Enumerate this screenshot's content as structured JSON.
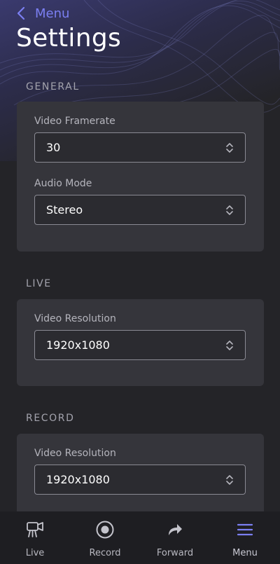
{
  "header": {
    "back_label": "Menu",
    "title": "Settings"
  },
  "sections": {
    "general": {
      "label": "GENERAL",
      "framerate_label": "Video Framerate",
      "framerate_value": "30",
      "audio_label": "Audio Mode",
      "audio_value": "Stereo"
    },
    "live": {
      "label": "LIVE",
      "resolution_label": "Video Resolution",
      "resolution_value": "1920x1080"
    },
    "record": {
      "label": "RECORD",
      "resolution_label": "Video Resolution",
      "resolution_value": "1920x1080"
    }
  },
  "tabbar": {
    "tabs": [
      {
        "label": "Live",
        "icon": "video-camera-icon"
      },
      {
        "label": "Record",
        "icon": "record-icon"
      },
      {
        "label": "Forward",
        "icon": "forward-arrow-icon"
      },
      {
        "label": "Menu",
        "icon": "menu-icon"
      }
    ],
    "active": "Menu"
  },
  "colors": {
    "accent": "#7b7ff2",
    "background": "#242428",
    "card": "#35353b",
    "tabbar": "#1e1e22"
  }
}
